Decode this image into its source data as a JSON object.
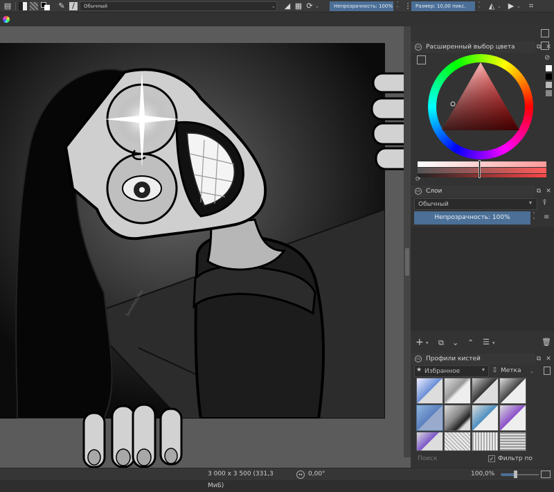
{
  "toolbar": {
    "blend_mode": "Обычный",
    "opacity_label": "Непрозрачность: 100%",
    "size_label": "Размер: 10,00 пикс."
  },
  "docker_color": {
    "title": "Расширенный выбор цвета"
  },
  "docker_layers": {
    "title": "Слои",
    "blend_mode": "Обычный",
    "opacity_label": "Непрозрачность:",
    "opacity_value": "100%"
  },
  "docker_brushes": {
    "title": "Профили кистей",
    "tag_selector": "Избранное",
    "tag_button": "Метка",
    "search_placeholder": "Поиск",
    "filter_label": "Фильтр по метке",
    "filter_checked": true
  },
  "canvas": {
    "signature": "Somebodyday"
  },
  "statusbar": {
    "image_size": "3 000 x 3 500 (331,3 МиБ)",
    "rotation": "0,00°",
    "zoom": "100,0%"
  },
  "colors": {
    "accent": "#4b6f96",
    "panel": "#333333",
    "canvas_bg": "#5b5b5b"
  }
}
